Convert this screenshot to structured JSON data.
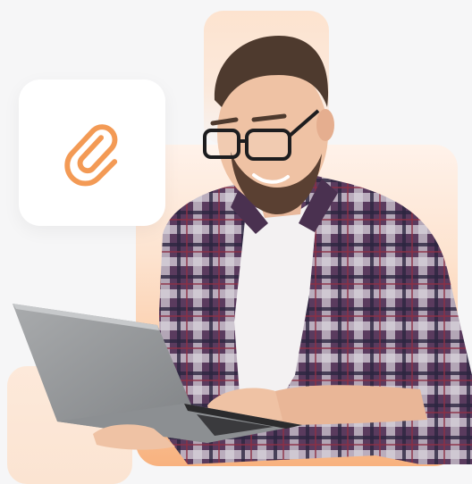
{
  "colors": {
    "background": "#f6f6f7",
    "accent": "#f39a55",
    "tile_peach": "#fde3cf",
    "card": "#ffffff"
  },
  "icons": {
    "attachment": "paperclip-icon"
  }
}
